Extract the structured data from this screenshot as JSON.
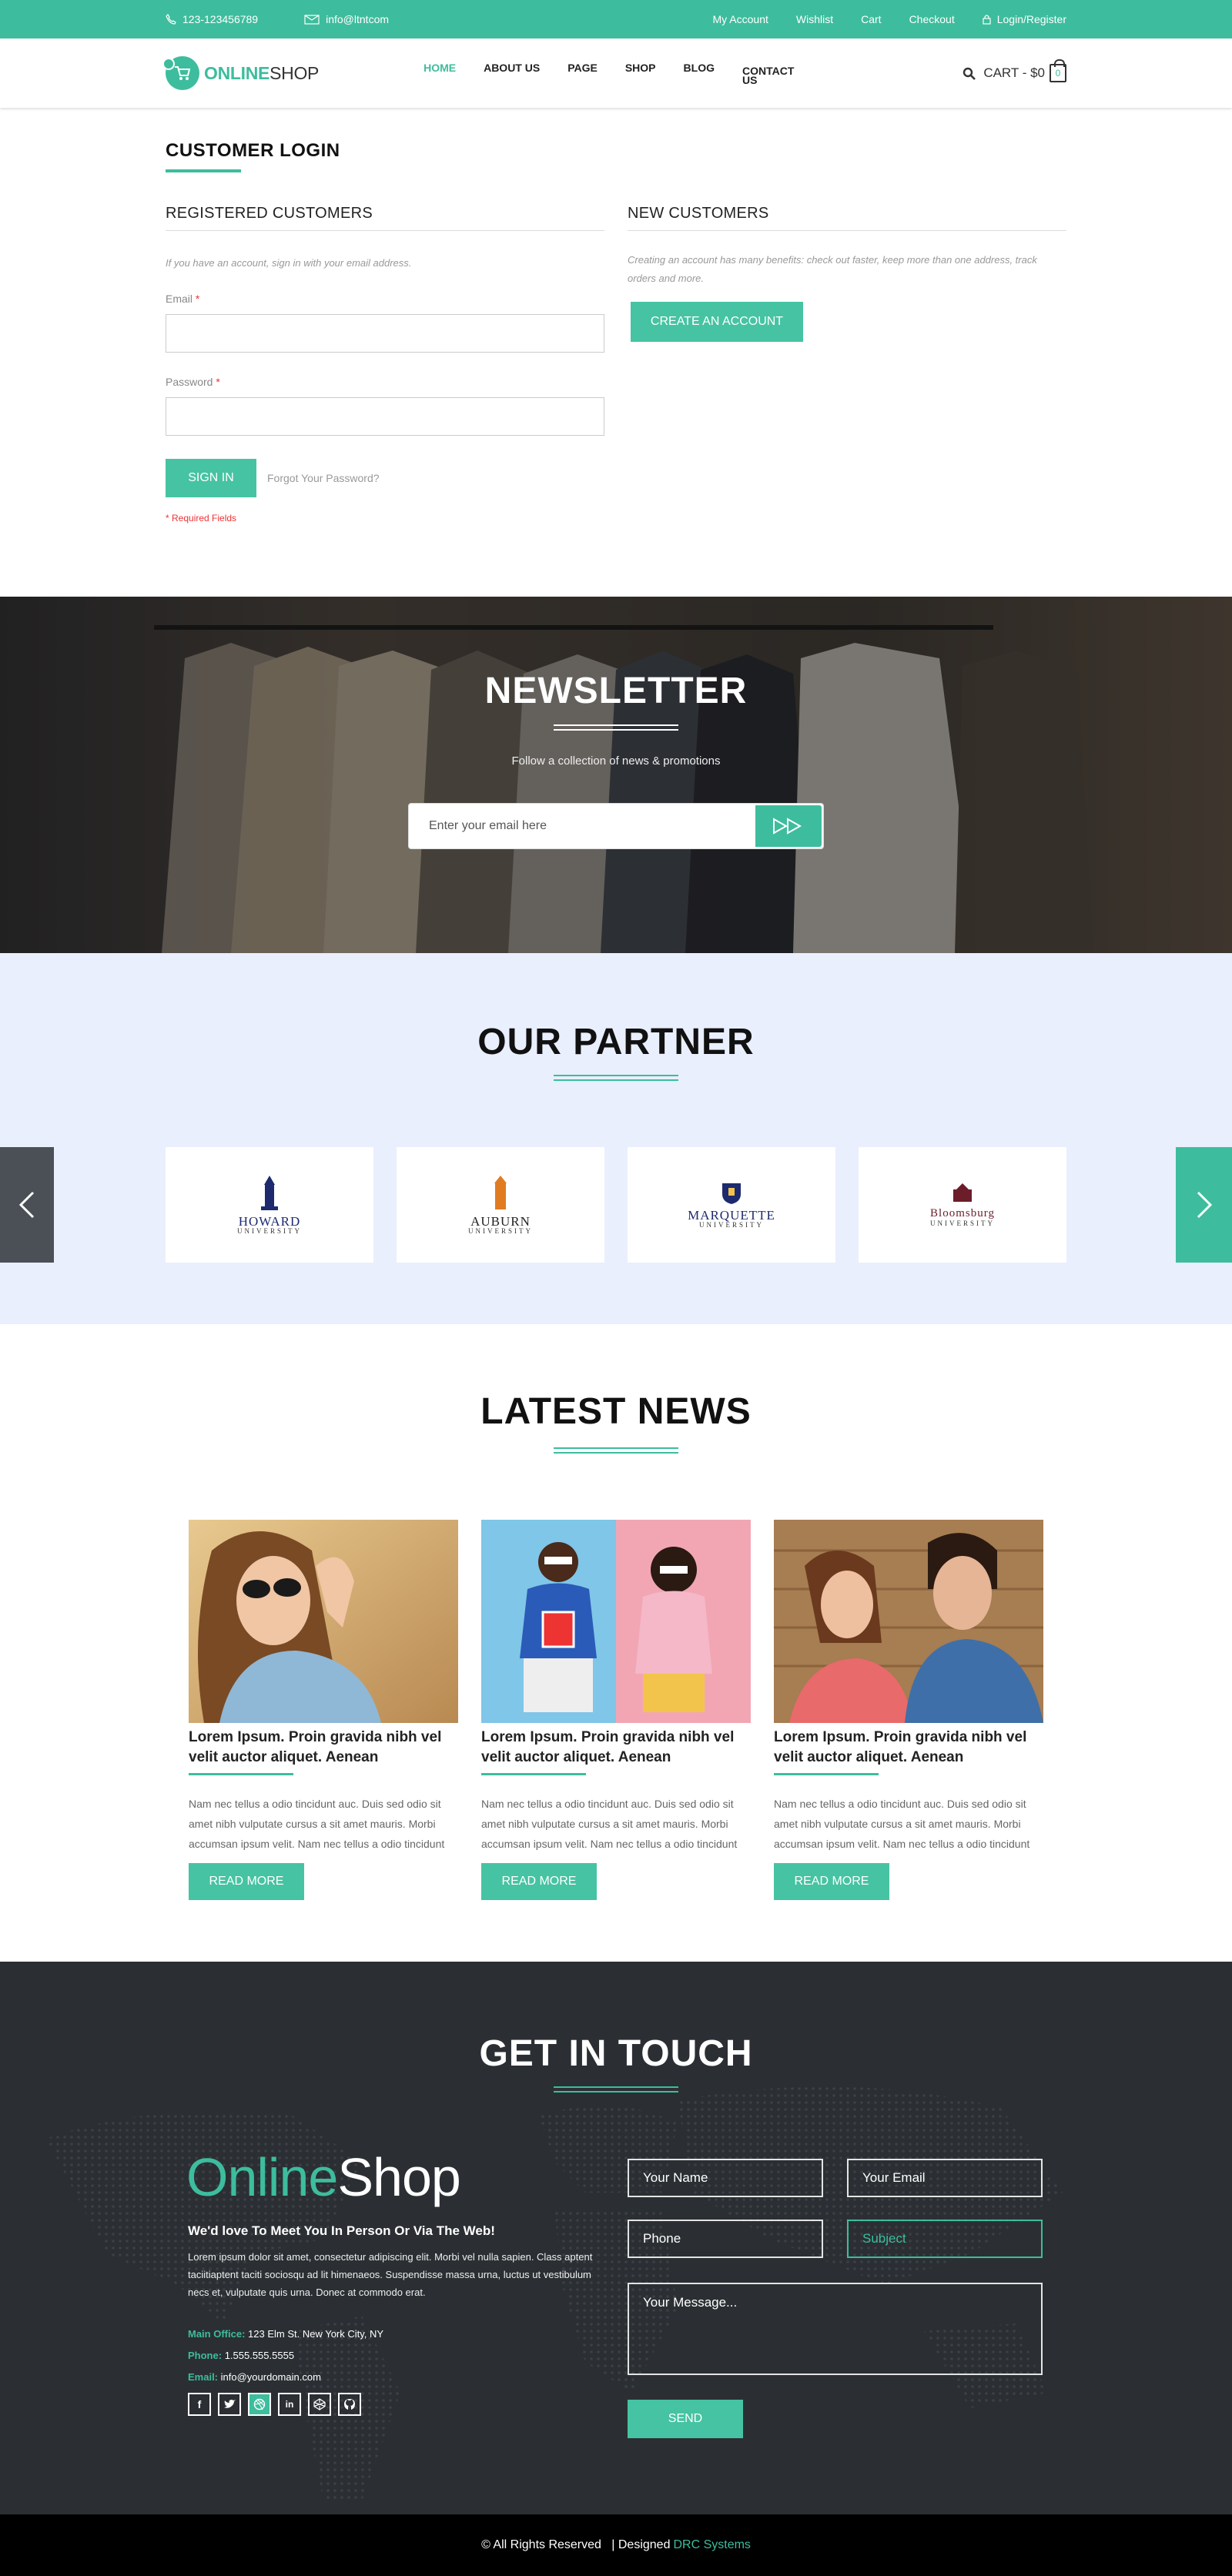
{
  "topbar": {
    "phone": "123-123456789",
    "email": "info@ltntcom",
    "links": [
      "My Account",
      "Wishlist",
      "Cart",
      "Checkout"
    ],
    "login": "Login/Register",
    "color": "#3dbd9d"
  },
  "header": {
    "logo_a": "ONLINE",
    "logo_b": "SHOP",
    "nav": [
      "HOME",
      "ABOUT US",
      "PAGE",
      "SHOP",
      "BLOG",
      "CONTACT US"
    ],
    "cart_label": "CART - $0",
    "cart_count": "0"
  },
  "login": {
    "title": "CUSTOMER LOGIN",
    "registered": {
      "heading": "REGISTERED CUSTOMERS",
      "note": "If you have an account, sign in with your email address.",
      "email_label": "Email",
      "password_label": "Password",
      "required_mark": "*",
      "sign_in": "SIGN IN",
      "forgot": "Forgot Your Password?",
      "required_note": "* Required Fields"
    },
    "new_customers": {
      "heading": "NEW CUSTOMERS",
      "note": "Creating an account has many benefits: check out faster, keep more than one address, track orders and more.",
      "create": "CREATE AN ACCOUNT"
    }
  },
  "newsletter": {
    "title": "NEWSLETTER",
    "subtitle": "Follow a collection of news & promotions",
    "placeholder": "Enter your email here"
  },
  "partner": {
    "title": "OUR PARTNER",
    "logos": [
      {
        "name": "HOWARD",
        "sub": "UNIVERSITY"
      },
      {
        "name": "AUBURN",
        "sub": "UNIVERSITY"
      },
      {
        "name": "MARQUETTE",
        "sub": "UNIVERSITY"
      },
      {
        "name": "Bloomsburg",
        "sub": "UNIVERSITY"
      }
    ]
  },
  "news": {
    "title": "LATEST NEWS",
    "items": [
      {
        "title": "Lorem Ipsum. Proin gravida nibh vel velit auctor aliquet. Aenean",
        "body": "Nam nec tellus a odio tincidunt auc. Duis sed odio sit amet nibh vulputate cursus a sit amet mauris. Morbi accumsan ipsum velit. Nam nec tellus a odio tincidunt",
        "button": "READ MORE"
      },
      {
        "title": "Lorem Ipsum. Proin gravida nibh vel velit auctor aliquet. Aenean",
        "body": "Nam nec tellus a odio tincidunt auc. Duis sed odio sit amet nibh vulputate cursus a sit amet mauris. Morbi accumsan ipsum velit. Nam nec tellus a odio tincidunt",
        "button": "READ MORE"
      },
      {
        "title": "Lorem Ipsum. Proin gravida nibh vel velit auctor aliquet. Aenean",
        "body": "Nam nec tellus a odio tincidunt auc. Duis sed odio sit amet nibh vulputate cursus a sit amet mauris. Morbi accumsan ipsum velit. Nam nec tellus a odio tincidunt",
        "button": "READ MORE"
      }
    ]
  },
  "contact": {
    "title": "GET IN TOUCH",
    "logo_a": "Online",
    "logo_b": "Shop",
    "tagline": "We'd love To Meet You In Person Or Via The Web!",
    "body": "Lorem ipsum dolor sit amet, consectetur adipiscing elit. Morbi vel nulla sapien. Class aptent taciitiaptent taciti sociosqu ad lit himenaeos. Suspendisse massa urna, luctus ut vestibulum necs et, vulputate quis urna. Donec at commodo erat.",
    "office_label": "Main Office:",
    "office": "123 Elm St. New York City, NY",
    "phone_label": "Phone:",
    "phone": "1.555.555.5555",
    "email_label": "Email:",
    "email": "info@yourdomain.com",
    "social": [
      "facebook-icon",
      "twitter-icon",
      "dribbble-icon",
      "linkedin-icon",
      "codepen-icon",
      "github-icon"
    ],
    "form": {
      "name": "Your Name",
      "email": "Your Email",
      "phone": "Phone",
      "subject": "Subject",
      "message": "Your Message...",
      "send": "SEND"
    }
  },
  "footer": {
    "text": "© All Rights Reserved   | Designed",
    "brand": "DRC Systems"
  }
}
